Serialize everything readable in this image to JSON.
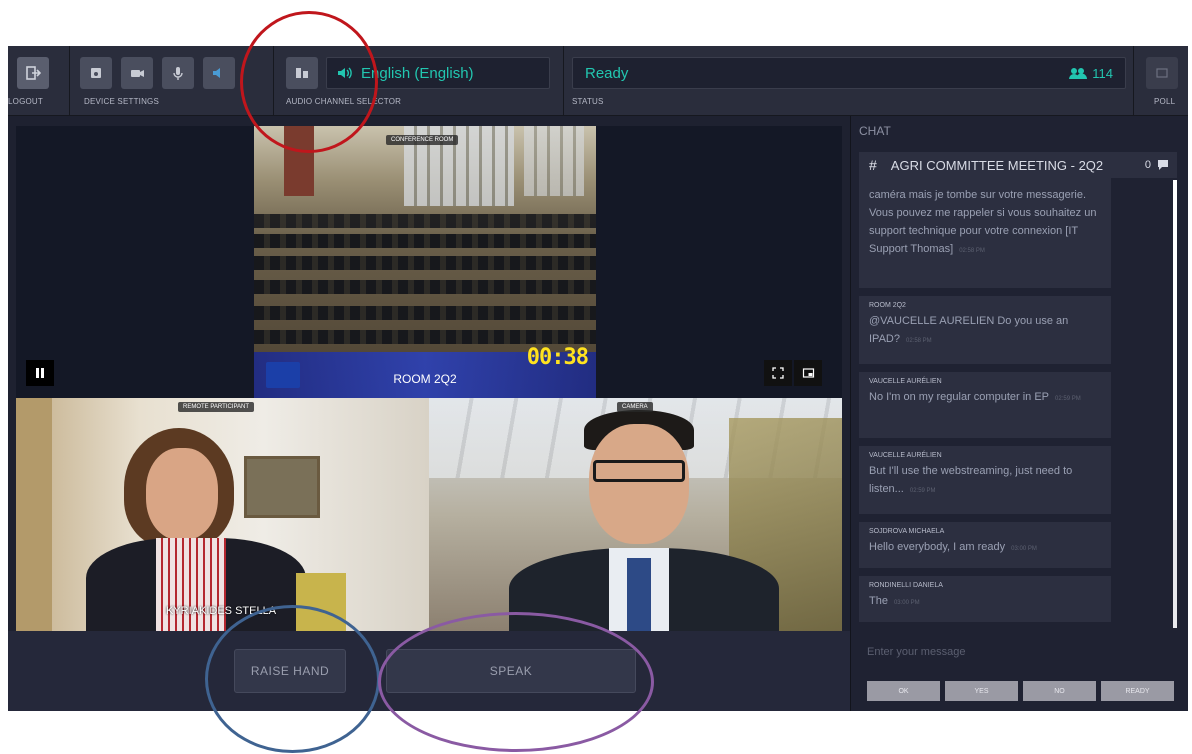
{
  "toolbar": {
    "logout_label": "LOGOUT",
    "device_settings_label": "DEVICE SETTINGS",
    "audio_channel_label": "AUDIO CHANNEL SELECTOR",
    "audio_channel_value": "English (English)",
    "status_label": "STATUS",
    "status_value": "Ready",
    "user_count": "114",
    "poll_label": "POLL"
  },
  "video": {
    "room_tag": "CONFERENCE ROOM",
    "room_name": "ROOM 2Q2",
    "timer": "00:38",
    "remote_tag": "REMOTE PARTICIPANT",
    "remote_name": "KYRIAKIDES STELLA",
    "camera_tag": "CAMERA"
  },
  "controls": {
    "raise_hand": "RAISE HAND",
    "speak": "SPEAK"
  },
  "chat": {
    "title": "CHAT",
    "room": "AGRI COMMITTEE MEETING - 2Q2",
    "room_count": "0",
    "messages": [
      {
        "author": "",
        "text": "caméra mais je tombe sur votre messagerie. Vous pouvez me rappeler si vous souhaitez un support technique pour votre connexion [IT Support Thomas]",
        "time": "02:58 PM"
      },
      {
        "author": "ROOM 2Q2",
        "text": "@VAUCELLE AURELIEN Do you use an IPAD?",
        "time": "02:58 PM"
      },
      {
        "author": "VAUCELLE AURÉLIEN",
        "text": "No I'm on my regular computer in EP",
        "time": "02:59 PM"
      },
      {
        "author": "VAUCELLE AURÉLIEN",
        "text": "But I'll use the webstreaming, just need to listen...",
        "time": "02:59 PM"
      },
      {
        "author": "SOJDROVA MICHAELA",
        "text": "Hello everybody, I am ready",
        "time": "03:00 PM"
      },
      {
        "author": "RONDINELLI DANIELA",
        "text": "The",
        "time": "03:00 PM"
      }
    ],
    "input_placeholder": "Enter your message",
    "quick_replies": [
      "OK",
      "YES",
      "NO",
      "READY"
    ]
  },
  "colors": {
    "accent": "#22c6b0",
    "annotation_red": "#c0161c",
    "annotation_blue": "#3f6391",
    "annotation_purple": "#8a5aa3"
  }
}
